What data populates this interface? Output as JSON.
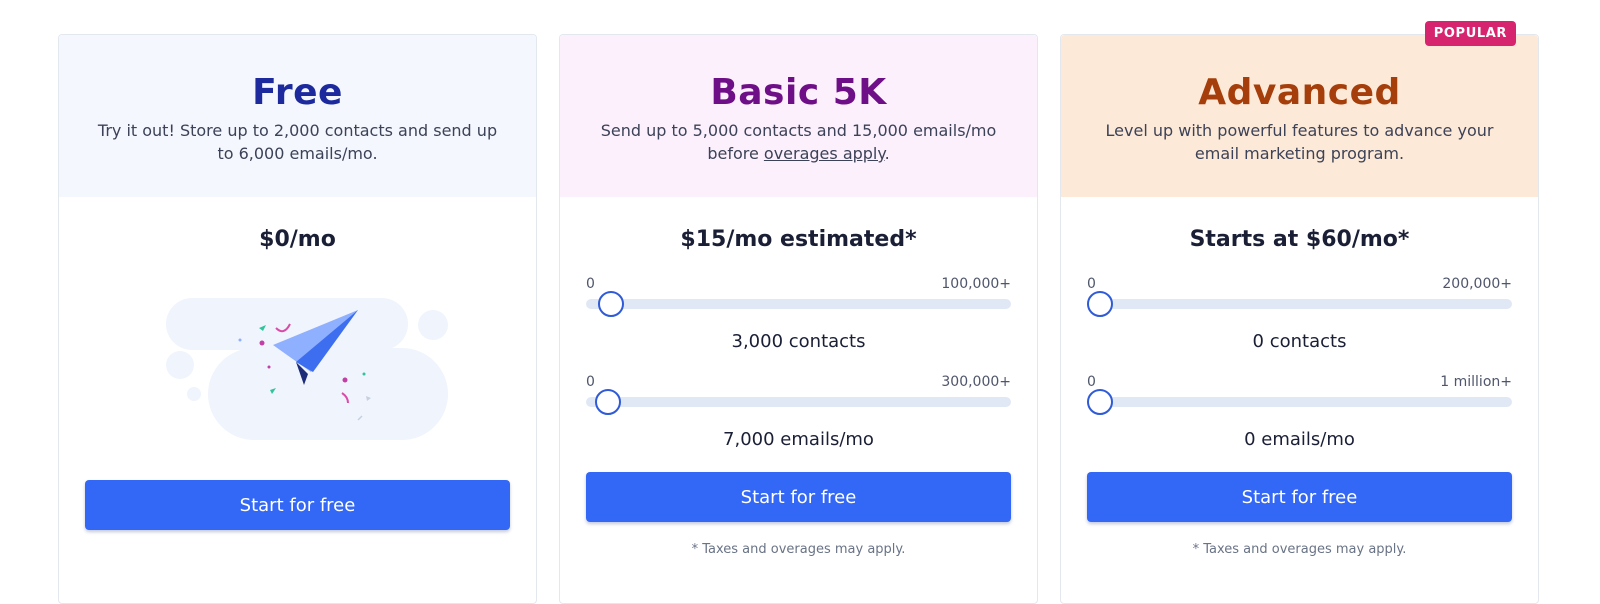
{
  "plans": {
    "free": {
      "name": "Free",
      "description": "Try it out! Store up to 2,000 contacts and send up to 6,000 emails/mo.",
      "price": "$0/mo",
      "cta_label": "Start for free"
    },
    "basic": {
      "name": "Basic 5K",
      "description_prefix": "Send up to 5,000 contacts and 15,000 emails/mo before ",
      "description_link": "overages apply",
      "description_suffix": ".",
      "price": "$15/mo estimated*",
      "contacts_slider": {
        "min_label": "0",
        "max_label": "100,000+",
        "value_label": "3,000 contacts",
        "value_fraction": 0.03
      },
      "emails_slider": {
        "min_label": "0",
        "max_label": "300,000+",
        "value_label": "7,000 emails/mo",
        "value_fraction": 0.023
      },
      "cta_label": "Start for free",
      "footnote": "* Taxes and overages may apply."
    },
    "advanced": {
      "name": "Advanced",
      "badge": "POPULAR",
      "description": "Level up with powerful features to advance your email marketing program.",
      "price": "Starts at $60/mo*",
      "contacts_slider": {
        "min_label": "0",
        "max_label": "200,000+",
        "value_label": "0 contacts",
        "value_fraction": 0
      },
      "emails_slider": {
        "min_label": "0",
        "max_label": "1 million+",
        "value_label": "0 emails/mo",
        "value_fraction": 0
      },
      "cta_label": "Start for free",
      "footnote": "* Taxes and overages may apply."
    }
  },
  "colors": {
    "accent": "#3367f6",
    "badge": "#d6246e",
    "free_title": "#1c2a9e",
    "basic_title": "#6f0f87",
    "advanced_title": "#a53e0b"
  },
  "icons": {
    "free_illustration": "paper-plane-icon"
  }
}
